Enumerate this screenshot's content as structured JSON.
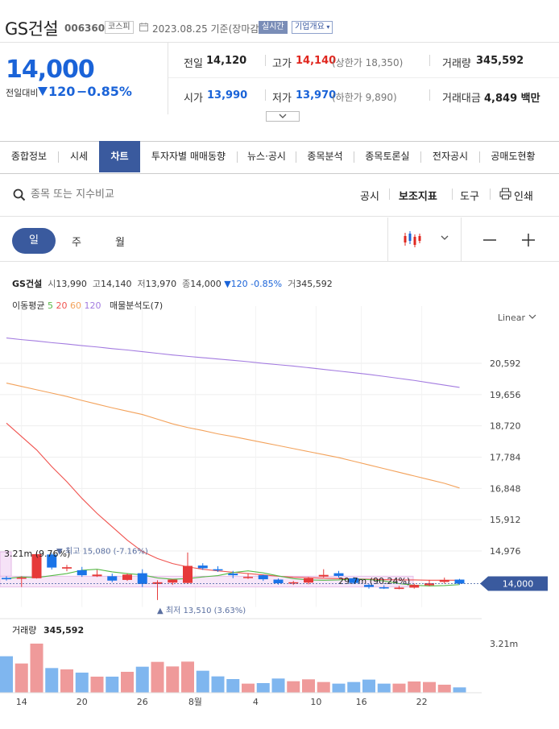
{
  "header": {
    "name": "GS건설",
    "code": "006360",
    "market": "코스피",
    "date": "2023.08.25 기준(장마감)",
    "realtime": "실시간",
    "overview": "기업개요"
  },
  "price": {
    "current": "14,000",
    "prev_label": "전일대비",
    "change": "120",
    "change_pct": "−0.85%"
  },
  "summary": {
    "prev_close": {
      "label": "전일",
      "value": "14,120"
    },
    "high": {
      "label": "고가",
      "value": "14,140",
      "sub": "(상한가 18,350)"
    },
    "volume": {
      "label": "거래량",
      "value": "345,592"
    },
    "open": {
      "label": "시가",
      "value": "13,990"
    },
    "low": {
      "label": "저가",
      "value": "13,970",
      "sub": "(하한가 9,890)"
    },
    "amount": {
      "label": "거래대금",
      "value": "4,849 백만"
    }
  },
  "tabs": [
    "종합정보",
    "시세",
    "차트",
    "투자자별 매매동향",
    "뉴스·공시",
    "종목분석",
    "종목토론실",
    "전자공시",
    "공매도현황"
  ],
  "toolbar": {
    "search_placeholder": "종목 또는 지수비교",
    "notice": "공시",
    "indicators": "보조지표",
    "tools": "도구",
    "print": "인쇄"
  },
  "periods": {
    "day": "일",
    "week": "주",
    "month": "월"
  },
  "info": {
    "name": "GS건설",
    "open_l": "시",
    "open": "13,990",
    "high_l": "고",
    "high": "14,140",
    "low_l": "저",
    "low": "13,970",
    "close_l": "종",
    "close": "14,000",
    "change": "▼120 -0.85%",
    "vol_l": "거",
    "vol": "345,592"
  },
  "ma": {
    "label": "이동평균",
    "p5": "5",
    "p20": "20",
    "p60": "60",
    "p120": "120",
    "profile": "매물분석도(7)",
    "colors": {
      "p5": "#56b947",
      "p20": "#f0534f",
      "p60": "#f3a25b",
      "p120": "#a37be0"
    }
  },
  "chart_data": {
    "type": "candlestick",
    "scale": "Linear",
    "y_ticks": [
      20592,
      19656,
      18720,
      17784,
      16848,
      15912,
      14976
    ],
    "ylim": [
      13300,
      21350
    ],
    "current_price": 14000,
    "current_price_label": "14,000",
    "annotations": {
      "high": "최고 15,080 (-7.16%)",
      "low": "최저 13,510 (3.63%)",
      "profile_top": "3.21m (9.76%)",
      "profile_bottom": "29.7m (90.24%)"
    },
    "x_labels": [
      "14",
      "20",
      "26",
      "8월",
      "4",
      "10",
      "16",
      "22"
    ],
    "candles": [
      {
        "o": 14170,
        "h": 14220,
        "l": 14090,
        "c": 14130
      },
      {
        "o": 14160,
        "h": 14220,
        "l": 13900,
        "c": 14180
      },
      {
        "o": 14160,
        "h": 14950,
        "l": 14150,
        "c": 14880
      },
      {
        "o": 14870,
        "h": 14920,
        "l": 14420,
        "c": 14480
      },
      {
        "o": 14450,
        "h": 14560,
        "l": 14370,
        "c": 14490
      },
      {
        "o": 14400,
        "h": 14500,
        "l": 14200,
        "c": 14250
      },
      {
        "o": 14220,
        "h": 14410,
        "l": 14200,
        "c": 14270
      },
      {
        "o": 14220,
        "h": 14300,
        "l": 14040,
        "c": 14090
      },
      {
        "o": 14110,
        "h": 14300,
        "l": 14080,
        "c": 14270
      },
      {
        "o": 14310,
        "h": 14430,
        "l": 13900,
        "c": 13990
      },
      {
        "o": 13990,
        "h": 14100,
        "l": 13510,
        "c": 14040
      },
      {
        "o": 14030,
        "h": 14130,
        "l": 13960,
        "c": 14120
      },
      {
        "o": 14020,
        "h": 14930,
        "l": 14000,
        "c": 14530
      },
      {
        "o": 14540,
        "h": 14610,
        "l": 14410,
        "c": 14460
      },
      {
        "o": 14430,
        "h": 14520,
        "l": 14350,
        "c": 14400
      },
      {
        "o": 14300,
        "h": 14380,
        "l": 14160,
        "c": 14250
      },
      {
        "o": 14170,
        "h": 14310,
        "l": 14140,
        "c": 14200
      },
      {
        "o": 14250,
        "h": 14270,
        "l": 14080,
        "c": 14130
      },
      {
        "o": 14120,
        "h": 14150,
        "l": 13970,
        "c": 14010
      },
      {
        "o": 14000,
        "h": 14080,
        "l": 13960,
        "c": 14040
      },
      {
        "o": 14030,
        "h": 14200,
        "l": 13980,
        "c": 14160
      },
      {
        "o": 14210,
        "h": 14430,
        "l": 14180,
        "c": 14260
      },
      {
        "o": 14310,
        "h": 14380,
        "l": 14180,
        "c": 14230
      },
      {
        "o": 14160,
        "h": 14190,
        "l": 13990,
        "c": 14020
      },
      {
        "o": 13960,
        "h": 14000,
        "l": 13850,
        "c": 13900
      },
      {
        "o": 13890,
        "h": 13950,
        "l": 13840,
        "c": 13880
      },
      {
        "o": 13840,
        "h": 13930,
        "l": 13830,
        "c": 13880
      },
      {
        "o": 13880,
        "h": 14000,
        "l": 13850,
        "c": 13960
      },
      {
        "o": 13950,
        "h": 14110,
        "l": 13920,
        "c": 14010
      },
      {
        "o": 14050,
        "h": 14180,
        "l": 14000,
        "c": 14110
      },
      {
        "o": 14120,
        "h": 14140,
        "l": 13970,
        "c": 14000
      }
    ],
    "volume_label": "거래량",
    "volume_value": "345,592",
    "volume_tick": "3.21m",
    "volume_ymax": 3.21,
    "volumes": [
      1.36,
      1.09,
      1.83,
      0.92,
      0.87,
      0.75,
      0.6,
      0.6,
      0.78,
      0.97,
      1.15,
      0.98,
      1.16,
      0.82,
      0.61,
      0.51,
      0.34,
      0.36,
      0.53,
      0.43,
      0.5,
      0.4,
      0.34,
      0.4,
      0.49,
      0.34,
      0.34,
      0.42,
      0.4,
      0.3,
      0.2
    ],
    "ma5": [
      14150,
      14200,
      14180,
      14240,
      14300,
      14400,
      14430,
      14350,
      14300,
      14260,
      14170,
      14130,
      14150,
      14200,
      14240,
      14330,
      14380,
      14320,
      14230,
      14150,
      14110,
      14100,
      14110,
      14140,
      14120,
      14080,
      14000,
      13950,
      13930,
      13940,
      13970
    ],
    "ma20_start": [
      18800,
      18400,
      18000,
      17500,
      17050,
      16550,
      16100,
      15700,
      15300,
      14960,
      14750,
      14600,
      14500,
      14430,
      14380,
      14340,
      14300,
      14260,
      14220,
      14190,
      14180,
      14160,
      14150,
      14140,
      14130,
      14120,
      14110,
      14110,
      14100,
      14100,
      14100
    ],
    "ma60": [
      20000,
      19900,
      19800,
      19700,
      19600,
      19480,
      19370,
      19260,
      19160,
      19060,
      18920,
      18780,
      18670,
      18580,
      18480,
      18400,
      18310,
      18220,
      18130,
      18040,
      17950,
      17860,
      17770,
      17660,
      17550,
      17440,
      17330,
      17220,
      17110,
      17000,
      16860
    ],
    "ma120": [
      21350,
      21300,
      21260,
      21210,
      21170,
      21120,
      21080,
      21030,
      20990,
      20940,
      20890,
      20840,
      20800,
      20760,
      20720,
      20680,
      20640,
      20590,
      20550,
      20510,
      20460,
      20410,
      20360,
      20310,
      20260,
      20200,
      20140,
      20080,
      20010,
      19940,
      19870
    ]
  }
}
